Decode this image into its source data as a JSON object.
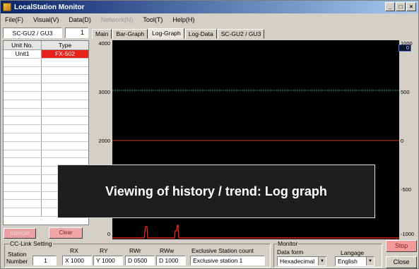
{
  "window": {
    "title": "LocalStation Monitor"
  },
  "menu": [
    "File(F)",
    "Visual(V)",
    "Data(D)",
    "Network(N)",
    "Tool(T)",
    "Help(H)"
  ],
  "menu_disabled": [
    false,
    false,
    false,
    true,
    false,
    false
  ],
  "unit_selector": {
    "value": "SC-GU2 / GU3",
    "number": "1"
  },
  "tabs": [
    "Main",
    "Bar-Graph",
    "Log-Graph",
    "Log-Data",
    "SC-GU2 / GU3"
  ],
  "active_tab": "Log-Graph",
  "unit_table": {
    "headers": [
      "Unit No.",
      "Type"
    ],
    "rows": [
      [
        "Unit1",
        "FX-502"
      ]
    ]
  },
  "buttons": {
    "error": "ERROR",
    "clear": "Clear",
    "stop": "Stop",
    "close": "Close"
  },
  "graph": {
    "left_axis": [
      "4000",
      "3000",
      "2000",
      "0"
    ],
    "right_axis": [
      "1000",
      "500",
      "0",
      "-500",
      "-1000"
    ],
    "value_badge": "0",
    "colors": {
      "background": "#000000",
      "line_3000": "#2fa86a",
      "line_2000": "#d33a2a",
      "trace": "#ff2a1a"
    }
  },
  "banner": "Viewing of history / trend: Log graph",
  "cc_link": {
    "title": "CC-Link Setting",
    "station_label_1": "Station",
    "station_label_2": "Number",
    "station_value": "1",
    "fields": [
      {
        "label": "RX",
        "value": "X 1000"
      },
      {
        "label": "RY",
        "value": "Y 1000"
      },
      {
        "label": "RWr",
        "value": "D 0500"
      },
      {
        "label": "RWw",
        "value": "D 1000"
      }
    ],
    "exclusive_label": "Exclusive Station count",
    "exclusive_value": "Exclusive station 1"
  },
  "monitor": {
    "title": "Monitor",
    "data_form_label": "Data form",
    "data_form_value": "Hexadecimal",
    "language_label": "Langage",
    "language_value": "English"
  }
}
